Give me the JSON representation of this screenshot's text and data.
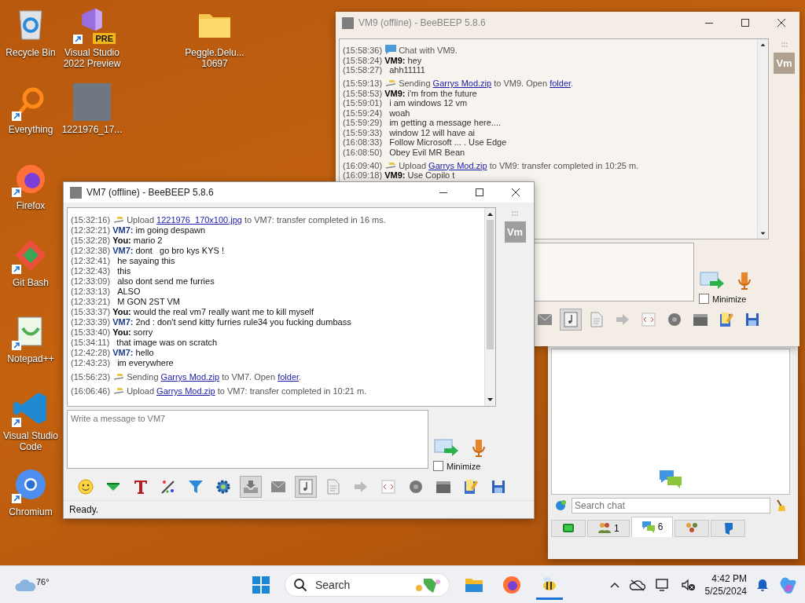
{
  "desktop_icons": [
    {
      "label": "Recycle Bin",
      "kind": "recycle-bin",
      "shortcut": false
    },
    {
      "label": "Visual Studio 2022 Preview",
      "kind": "vs-preview",
      "badge": "PRE",
      "shortcut": true
    },
    {
      "label": "Peggle.Delu... 10697",
      "kind": "folder",
      "shortcut": false
    },
    {
      "label": "Everything",
      "kind": "everything",
      "shortcut": true
    },
    {
      "label": "1221976_17...",
      "kind": "photo",
      "shortcut": false
    },
    {
      "label": "Firefox",
      "kind": "firefox",
      "shortcut": true
    },
    {
      "label": "Git Bash",
      "kind": "git-bash",
      "shortcut": true
    },
    {
      "label": "Notepad++",
      "kind": "notepad",
      "shortcut": true
    },
    {
      "label": "Visual Studio Code",
      "kind": "vscode",
      "shortcut": true
    },
    {
      "label": "Chromium",
      "kind": "chromium",
      "shortcut": true
    }
  ],
  "vm9_window": {
    "title": "VM9 (offline) - BeeBEEP 5.8.6",
    "avatar": "Vm",
    "messages": [
      {
        "kind": "system",
        "time": "(15:58:36)",
        "text": "Chat with VM9."
      },
      {
        "kind": "message",
        "time": "(15:58:24)",
        "sender": "VM9:",
        "color": "#000000",
        "text": "hey"
      },
      {
        "kind": "message",
        "time": "(15:58:27)",
        "text": "ahh11111"
      },
      {
        "kind": "file",
        "time": "(15:59:13)",
        "parts": [
          {
            "text": "Sending "
          },
          {
            "link": "Garrys Mod.zip"
          },
          {
            "text": " to VM9. Open "
          },
          {
            "link": "folder"
          },
          {
            "text": "."
          }
        ]
      },
      {
        "kind": "message",
        "time": "(15:58:53)",
        "sender": "VM9:",
        "color": "#000000",
        "text": "i'm from the future"
      },
      {
        "kind": "message",
        "time": "(15:59:01)",
        "text": "i am windows 12 vm"
      },
      {
        "kind": "message",
        "time": "(15:59:24)",
        "text": "woah"
      },
      {
        "kind": "message",
        "time": "(15:59:29)",
        "text": "im getting a message here...."
      },
      {
        "kind": "message",
        "time": "(15:59:33)",
        "text": "window 12 will have ai"
      },
      {
        "kind": "message",
        "time": "(16:08:33)",
        "text": "Follow Microsoft ... . Use Edge"
      },
      {
        "kind": "message",
        "time": "(16:08:50)",
        "text": "Obey Evil MR Bean"
      },
      {
        "kind": "file",
        "time": "(16:09:40)",
        "parts": [
          {
            "text": "Upload "
          },
          {
            "link": "Garrys Mod.zip"
          },
          {
            "text": " to VM9: transfer completed in 10:25 m."
          }
        ]
      },
      {
        "kind": "message",
        "time": "(16:09:18)",
        "sender": "VM9:",
        "color": "#000000",
        "text": "Use Copilo t"
      }
    ],
    "minimize": {
      "label": "Minimize",
      "checked": false
    },
    "toolbar": [
      {
        "kind": "mail",
        "on": false
      },
      {
        "kind": "note",
        "on": true
      },
      {
        "kind": "doc",
        "on": false
      },
      {
        "kind": "arrow",
        "on": false
      },
      {
        "kind": "code",
        "on": false
      },
      {
        "kind": "disc",
        "on": false
      },
      {
        "kind": "film",
        "on": false
      },
      {
        "kind": "notes",
        "on": false
      },
      {
        "kind": "save",
        "on": false
      }
    ]
  },
  "main_window": {
    "search": {
      "placeholder": "Search chat"
    },
    "tabs": [
      {
        "kind": "home",
        "selected": false
      },
      {
        "kind": "users",
        "count": "1",
        "selected": false
      },
      {
        "kind": "chats",
        "count": "6",
        "selected": true
      },
      {
        "kind": "groups",
        "selected": false
      },
      {
        "kind": "share",
        "selected": false
      }
    ]
  },
  "vm7_window": {
    "title": "VM7 (offline) - BeeBEEP 5.8.6",
    "avatar": "Vm",
    "messages": [
      {
        "kind": "file",
        "time": "(15:32:16)",
        "parts": [
          {
            "text": "Upload "
          },
          {
            "link": "1221976_170x100.jpg"
          },
          {
            "text": " to VM7: transfer completed in 16 ms."
          }
        ]
      },
      {
        "kind": "message",
        "time": "(12:32:21)",
        "sender": "VM7:",
        "color": "#1c3a8a",
        "text": "im going despawn"
      },
      {
        "kind": "message",
        "time": "(15:32:28)",
        "sender": "You:",
        "color": "#000000",
        "text": "mario 2"
      },
      {
        "kind": "message",
        "time": "(12:32:38)",
        "sender": "VM7:",
        "color": "#1c3a8a",
        "text": "dont   go bro kys KYS !"
      },
      {
        "kind": "message",
        "time": "(12:32:41)",
        "text": "he sayaing this"
      },
      {
        "kind": "message",
        "time": "(12:32:43)",
        "text": "this"
      },
      {
        "kind": "message",
        "time": "(12:33:09)",
        "text": "also dont send me furries"
      },
      {
        "kind": "message",
        "time": "(12:33:13)",
        "text": "ALSO"
      },
      {
        "kind": "message",
        "time": "(12:33:21)",
        "text": "M GON 2ST VM"
      },
      {
        "kind": "message",
        "time": "(15:33:37)",
        "sender": "You:",
        "color": "#000000",
        "text": "would the real vm7 really want me to kill myself"
      },
      {
        "kind": "message",
        "time": "(12:33:39)",
        "sender": "VM7:",
        "color": "#1c3a8a",
        "text": "2nd : don't send kitty furries rule34 you fucking dumbass"
      },
      {
        "kind": "message",
        "time": "(15:33:40)",
        "sender": "You:",
        "color": "#000000",
        "text": "sorry"
      },
      {
        "kind": "message",
        "time": "(15:34:11)",
        "text": "that image was on scratch"
      },
      {
        "kind": "message",
        "time": "(12:42:28)",
        "sender": "VM7:",
        "color": "#1c3a8a",
        "text": "hello"
      },
      {
        "kind": "message",
        "time": "(12:43:23)",
        "text": "im everywhere"
      },
      {
        "kind": "file",
        "time": "(15:56:23)",
        "parts": [
          {
            "text": "Sending "
          },
          {
            "link": "Garrys Mod.zip"
          },
          {
            "text": " to VM7. Open "
          },
          {
            "link": "folder"
          },
          {
            "text": "."
          }
        ]
      },
      {
        "kind": "file",
        "time": "(16:06:46)",
        "parts": [
          {
            "text": "Upload "
          },
          {
            "link": "Garrys Mod.zip"
          },
          {
            "text": " to VM7: transfer completed in 10:21 m."
          }
        ]
      }
    ],
    "input": {
      "placeholder": "Write a message to VM7"
    },
    "minimize": {
      "label": "Minimize",
      "checked": false
    },
    "toolbar": [
      {
        "kind": "smiley",
        "on": false
      },
      {
        "kind": "green-down",
        "on": false
      },
      {
        "kind": "text-color",
        "on": false
      },
      {
        "kind": "palette",
        "on": false
      },
      {
        "kind": "filter",
        "on": false
      },
      {
        "kind": "gear",
        "on": false
      },
      {
        "kind": "tray",
        "on": true
      },
      {
        "kind": "mail",
        "on": false
      },
      {
        "kind": "note",
        "on": true
      },
      {
        "kind": "doc",
        "on": false
      },
      {
        "kind": "arrow",
        "on": false
      },
      {
        "kind": "code",
        "on": false
      },
      {
        "kind": "disc",
        "on": false
      },
      {
        "kind": "film",
        "on": false
      },
      {
        "kind": "notes",
        "on": false
      },
      {
        "kind": "save",
        "on": false
      }
    ],
    "status": "Ready."
  },
  "taskbar": {
    "weather": "76°",
    "search": "Search",
    "apps": [
      {
        "kind": "explorer",
        "active": false
      },
      {
        "kind": "firefox",
        "active": false
      },
      {
        "kind": "beebeep",
        "active": true
      }
    ],
    "time": "4:42 PM",
    "date": "5/25/2024"
  }
}
